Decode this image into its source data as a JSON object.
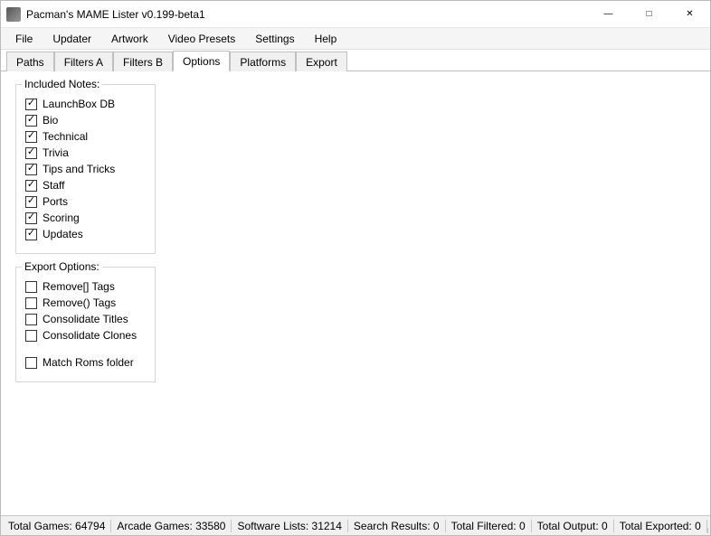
{
  "window": {
    "title": "Pacman's MAME Lister v0.199-beta1"
  },
  "menu": {
    "items": [
      "File",
      "Updater",
      "Artwork",
      "Video Presets",
      "Settings",
      "Help"
    ]
  },
  "tabs": {
    "items": [
      "Paths",
      "Filters A",
      "Filters B",
      "Options",
      "Platforms",
      "Export"
    ],
    "active_index": 3
  },
  "included_notes": {
    "legend": "Included Notes:",
    "items": [
      {
        "label": "LaunchBox DB",
        "checked": true
      },
      {
        "label": "Bio",
        "checked": true
      },
      {
        "label": "Technical",
        "checked": true
      },
      {
        "label": "Trivia",
        "checked": true
      },
      {
        "label": "Tips and Tricks",
        "checked": true
      },
      {
        "label": "Staff",
        "checked": true
      },
      {
        "label": "Ports",
        "checked": true
      },
      {
        "label": "Scoring",
        "checked": true
      },
      {
        "label": "Updates",
        "checked": true
      }
    ]
  },
  "export_options": {
    "legend": "Export Options:",
    "items": [
      {
        "label": "Remove[] Tags",
        "checked": false
      },
      {
        "label": "Remove() Tags",
        "checked": false
      },
      {
        "label": "Consolidate Titles",
        "checked": false
      },
      {
        "label": "Consolidate Clones",
        "checked": false
      }
    ],
    "extra": {
      "label": "Match Roms folder",
      "checked": false
    }
  },
  "status": {
    "total_games_label": "Total Games: 64794",
    "arcade_games_label": "Arcade Games: 33580",
    "software_lists_label": "Software Lists: 31214",
    "search_results_label": "Search Results: 0",
    "total_filtered_label": "Total Filtered: 0",
    "total_output_label": "Total Output: 0",
    "total_exported_label": "Total Exported: 0"
  }
}
